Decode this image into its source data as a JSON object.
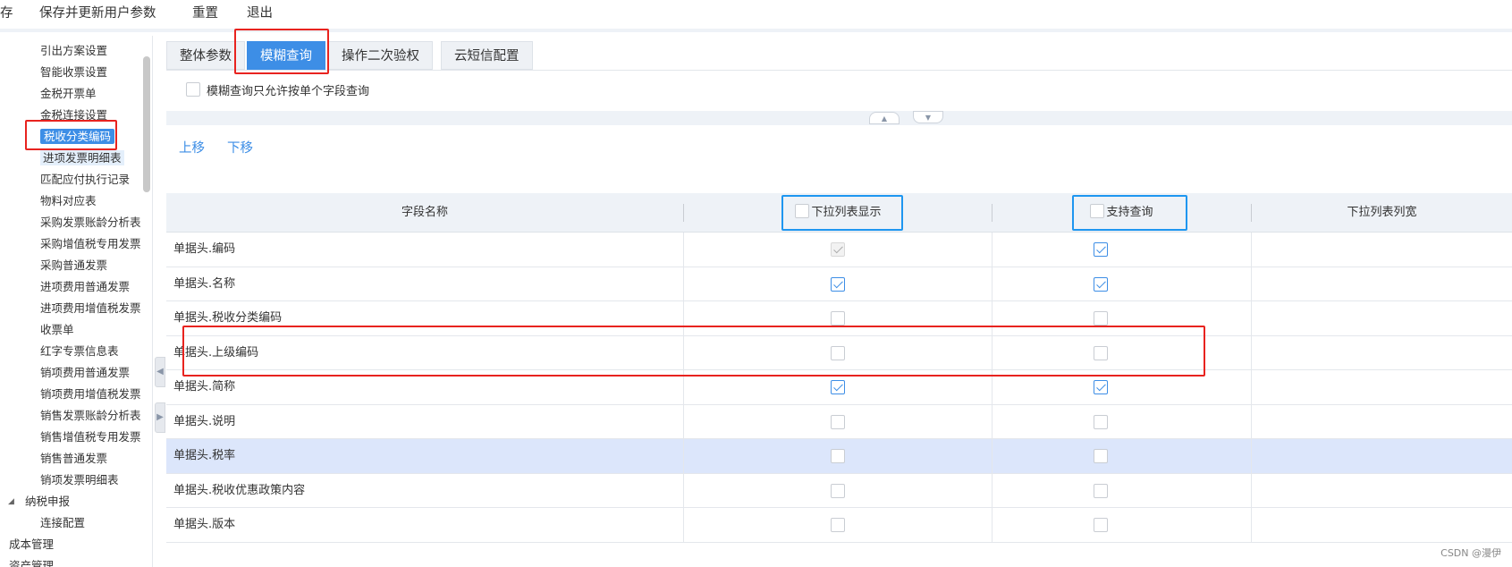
{
  "topmenu": {
    "save_partial": "存",
    "save_update": "保存并更新用户参数",
    "reset": "重置",
    "exit": "退出"
  },
  "sidebar": {
    "items": [
      {
        "label": "引出方案设置"
      },
      {
        "label": "智能收票设置"
      },
      {
        "label": "金税开票单"
      },
      {
        "label": "金税连接设置"
      },
      {
        "label": "税收分类编码"
      },
      {
        "label": "进项发票明细表"
      },
      {
        "label": "匹配应付执行记录"
      },
      {
        "label": "物料对应表"
      },
      {
        "label": "采购发票账龄分析表"
      },
      {
        "label": "采购增值税专用发票"
      },
      {
        "label": "采购普通发票"
      },
      {
        "label": "进项费用普通发票"
      },
      {
        "label": "进项费用增值税发票"
      },
      {
        "label": "收票单"
      },
      {
        "label": "红字专票信息表"
      },
      {
        "label": "销项费用普通发票"
      },
      {
        "label": "销项费用增值税发票"
      },
      {
        "label": "销售发票账龄分析表"
      },
      {
        "label": "销售增值税专用发票"
      },
      {
        "label": "销售普通发票"
      },
      {
        "label": "销项发票明细表"
      }
    ],
    "group_tax_declare": "纳税申报",
    "group_tax_declare_child": "连接配置",
    "cost_mgmt": "成本管理",
    "partial_next": "资产管理"
  },
  "tabs": [
    {
      "label": "整体参数"
    },
    {
      "label": "模糊查询"
    },
    {
      "label": "操作二次验权"
    },
    {
      "label": "云短信配置"
    }
  ],
  "option": {
    "label": "模糊查询只允许按单个字段查询",
    "checked": false
  },
  "actions": {
    "move_up": "上移",
    "move_down": "下移"
  },
  "grid": {
    "columns": {
      "field_name": "字段名称",
      "dropdown_display": "下拉列表显示",
      "support_query": "支持查询",
      "dropdown_width": "下拉列表列宽"
    },
    "rows": [
      {
        "field": "单据头.编码",
        "dropdown": true,
        "query": true,
        "dropdown_disabled": true
      },
      {
        "field": "单据头.名称",
        "dropdown": true,
        "query": true
      },
      {
        "field": "单据头.税收分类编码",
        "dropdown": false,
        "query": false
      },
      {
        "field": "单据头.上级编码",
        "dropdown": false,
        "query": false
      },
      {
        "field": "单据头.简称",
        "dropdown": true,
        "query": true
      },
      {
        "field": "单据头.说明",
        "dropdown": false,
        "query": false
      },
      {
        "field": "单据头.税率",
        "dropdown": false,
        "query": false,
        "selected": true
      },
      {
        "field": "单据头.税收优惠政策内容",
        "dropdown": false,
        "query": false
      },
      {
        "field": "单据头.版本",
        "dropdown": false,
        "query": false
      }
    ]
  },
  "watermark": "CSDN @漫伊",
  "colors": {
    "accent": "#3d8ee6",
    "highlight_red": "#e8231f",
    "highlight_blue": "#1e96f0",
    "selected_row": "#dce6fb"
  }
}
